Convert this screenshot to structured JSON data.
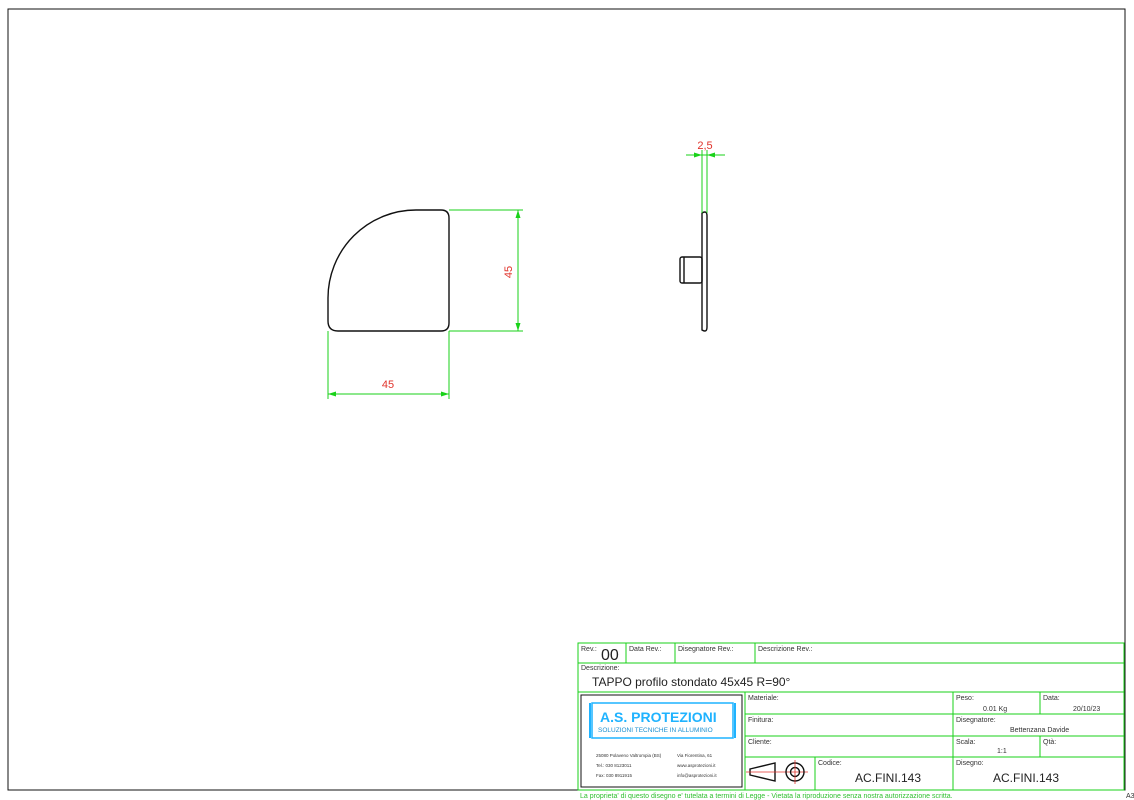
{
  "dimensions": {
    "width_front": "45",
    "height_front": "45",
    "thickness_side": "2,5"
  },
  "title_block": {
    "rev_label": "Rev.:",
    "rev_value": "00",
    "data_rev_label": "Data Rev.:",
    "disegnatore_rev_label": "Disegnatore Rev.:",
    "descrizione_rev_label": "Descrizione Rev.:",
    "descrizione_label": "Descrizione:",
    "descrizione_value": "TAPPO profilo stondato 45x45  R=90°",
    "materiale_label": "Materiale:",
    "finitura_label": "Finitura:",
    "cliente_label": "Cliente:",
    "peso_label": "Peso:",
    "peso_value": "0.01  Kg",
    "data_label": "Data:",
    "data_value": "20/10/23",
    "disegnatore_label": "Disegnatore:",
    "disegnatore_value": "Bettenzana Davide",
    "scala_label": "Scala:",
    "scala_value": "1:1",
    "qta_label": "Qtà:",
    "codice_label": "Codice:",
    "codice_value": "AC.FINI.143",
    "disegno_label": "Disegno:",
    "disegno_value": "AC.FINI.143",
    "sheet_size": "A3"
  },
  "logo": {
    "company": "A.S. PROTEZIONI",
    "tagline": "SOLUZIONI TECNICHE IN ALLUMINIO",
    "line1_left": "25080 Polaveno Valtrompia (BS)",
    "line1_right": "Via Fiorentina, 61",
    "line2_left": "Tel.: 030 8123011",
    "line2_right": "www.asprotezioni.it",
    "line3_left": "Fax: 030 8911915",
    "line3_right": "info@asprotezioni.it"
  },
  "footer_notice": "La proprieta' di questo disegno e' tutelata a termini di Legge - Vietata la riproduzione senza nostra autorizzazione scritta.",
  "colors": {
    "border": "#111111",
    "dimension_lines": "#19d219",
    "dimension_text": "#e0332b",
    "logo_blue": "#1fb3ff"
  }
}
